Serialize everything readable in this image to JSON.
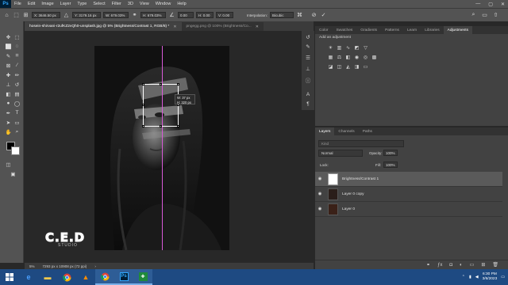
{
  "menubar": {
    "app_logo": "Ps",
    "items": [
      "File",
      "Edit",
      "Image",
      "Layer",
      "Type",
      "Select",
      "Filter",
      "3D",
      "View",
      "Window",
      "Help"
    ],
    "window_controls": [
      "—",
      "▢",
      "✕"
    ]
  },
  "options": {
    "x_value": "X: 3646.50 px",
    "y_value": "Y: 3179.16 px",
    "w_value": "W: 679.03%",
    "h_value": "H: 679.03%",
    "angle_value": "0.00",
    "h_skew": "H: 0.00",
    "v_skew": "V: 0.00",
    "interpolation_label": "Interpolation:",
    "interpolation_value": "Bicubic"
  },
  "tabs": [
    {
      "label": "hosein-shirvani-r2ufKZ2vQh0-unsplash.jpg @ 5% (Brightness/Contrast 1, RGB/8) *",
      "active": true
    },
    {
      "label": "pngegg.png @ 100% (Brightness/Co...",
      "active": false
    }
  ],
  "canvas": {
    "tooltip_line1": "W: 37 px",
    "tooltip_line2": "H: 320 px",
    "watermark_main": "C.E.D",
    "watermark_sub": "STUDIO"
  },
  "statusbar": {
    "zoom": "5%",
    "doc_size": "7293 px x 10908 px (72 ppi)"
  },
  "adjustments_panel": {
    "tabs": [
      "Color",
      "Swatches",
      "Gradients",
      "Patterns",
      "Learn",
      "Libraries",
      "Adjustments"
    ],
    "active_tab": "Adjustments",
    "title": "Add an adjustment"
  },
  "layers_panel": {
    "tabs": [
      "Layers",
      "Channels",
      "Paths"
    ],
    "active_tab": "Layers",
    "filter_placeholder": "Kind",
    "blend_mode": "Normal",
    "opacity_label": "Opacity:",
    "opacity_value": "100%",
    "lock_label": "Lock:",
    "fill_label": "Fill:",
    "fill_value": "100%",
    "layers": [
      {
        "name": "Brightness/Contrast 1",
        "selected": true
      },
      {
        "name": "Layer 0 copy",
        "selected": false
      },
      {
        "name": "Layer 0",
        "selected": false
      }
    ]
  },
  "taskbar": {
    "apps": [
      "ie-icon",
      "folder-icon",
      "chrome-icon",
      "vlc-icon",
      "chrome-icon",
      "photoshop-icon",
      "camtasia-icon"
    ],
    "time": "6:30 PM",
    "date": "3/6/2023"
  }
}
